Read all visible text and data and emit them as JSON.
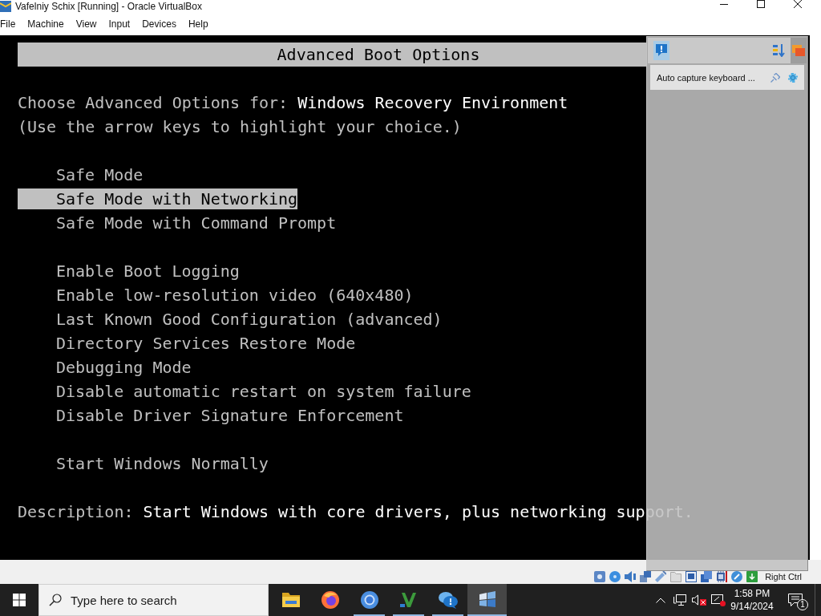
{
  "window": {
    "title": "Vafelniy Schix [Running] - Oracle VirtualBox"
  },
  "menu": [
    "File",
    "Machine",
    "View",
    "Input",
    "Devices",
    "Help"
  ],
  "boot_screen": {
    "header": "Advanced Boot Options",
    "prompt_label": "Choose Advanced Options for:",
    "prompt_target": "Windows Recovery Environment",
    "hint": "(Use the arrow keys to highlight your choice.)",
    "option_groups": [
      {
        "items": [
          {
            "label": "Safe Mode",
            "selected": false
          },
          {
            "label": "Safe Mode with Networking",
            "selected": true
          },
          {
            "label": "Safe Mode with Command Prompt",
            "selected": false
          }
        ]
      },
      {
        "items": [
          {
            "label": "Enable Boot Logging",
            "selected": false
          },
          {
            "label": "Enable low-resolution video (640x480)",
            "selected": false
          },
          {
            "label": "Last Known Good Configuration (advanced)",
            "selected": false
          },
          {
            "label": "Directory Services Restore Mode",
            "selected": false
          },
          {
            "label": "Debugging Mode",
            "selected": false
          },
          {
            "label": "Disable automatic restart on system failure",
            "selected": false
          },
          {
            "label": "Disable Driver Signature Enforcement",
            "selected": false
          }
        ]
      },
      {
        "items": [
          {
            "label": "Start Windows Normally",
            "selected": false
          }
        ]
      }
    ],
    "description_label": "Description:",
    "description": "Start Windows with core drivers, plus networking support."
  },
  "notification_center": {
    "messages": [
      {
        "text": "Auto capture keyboard ..."
      }
    ]
  },
  "status_bar": {
    "host_key": "Right Ctrl"
  },
  "taskbar": {
    "search": {
      "placeholder": "Type here to search"
    },
    "apps": [
      {
        "kind": "folder",
        "running": false,
        "selected": false
      },
      {
        "kind": "fox",
        "running": false,
        "selected": false
      },
      {
        "kind": "ring",
        "running": true,
        "selected": false
      },
      {
        "kind": "chevron",
        "running": true,
        "selected": false
      },
      {
        "kind": "bubbles",
        "running": true,
        "selected": false
      },
      {
        "kind": "flag",
        "running": true,
        "selected": true
      }
    ],
    "clock": {
      "time": "1:58 PM",
      "date": "9/14/2024"
    },
    "notifications": {
      "count": "1"
    }
  }
}
